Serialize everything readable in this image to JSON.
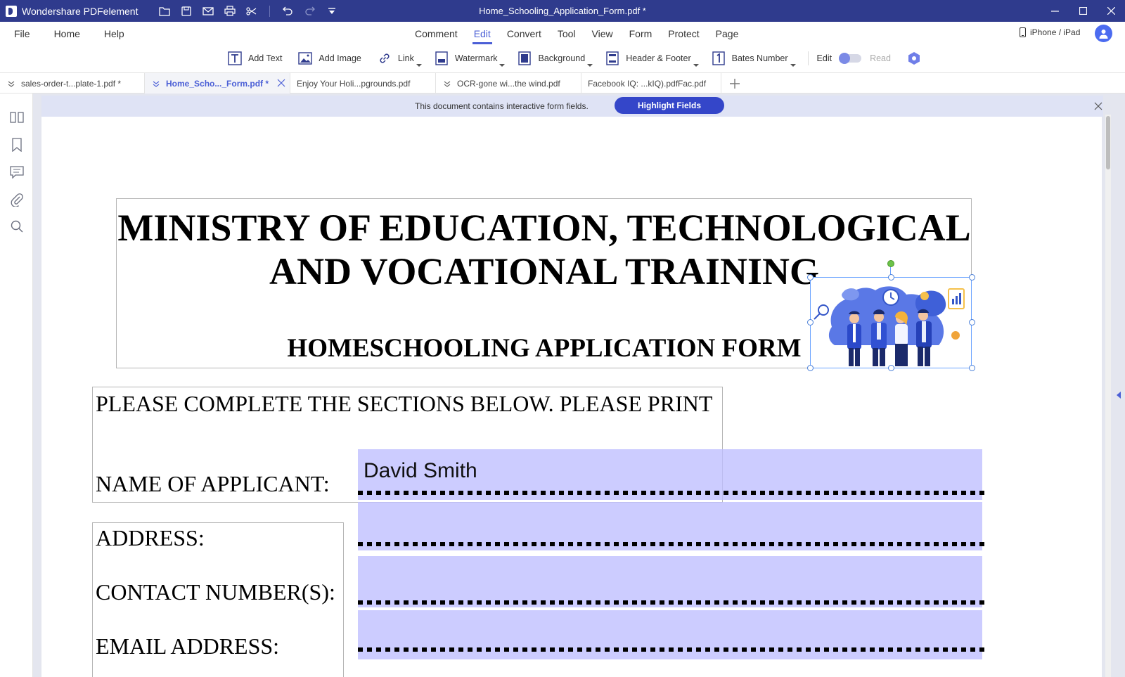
{
  "app": {
    "name": "Wondershare PDFelement",
    "window_title": "Home_Schooling_Application_Form.pdf *"
  },
  "menu": {
    "left": [
      "File",
      "Home",
      "Help"
    ],
    "center": [
      "Comment",
      "Edit",
      "Convert",
      "Tool",
      "View",
      "Form",
      "Protect",
      "Page"
    ],
    "active": "Edit",
    "device_label": "iPhone / iPad"
  },
  "toolbar": {
    "add_text": "Add Text",
    "add_image": "Add Image",
    "link": "Link",
    "watermark": "Watermark",
    "background": "Background",
    "header_footer": "Header & Footer",
    "bates_number": "Bates Number",
    "mode_edit": "Edit",
    "mode_read": "Read"
  },
  "tabs": [
    {
      "label": "sales-order-t...plate-1.pdf *",
      "active": false
    },
    {
      "label": "Home_Scho..._Form.pdf *",
      "active": true
    },
    {
      "label": "Enjoy Your Holi...pgrounds.pdf",
      "active": false
    },
    {
      "label": "OCR-gone  wi...the wind.pdf",
      "active": false
    },
    {
      "label": "Facebook  IQ:   ...kIQ).pdfFac.pdf",
      "active": false
    }
  ],
  "notice": {
    "message": "This document contains interactive form fields.",
    "button": "Highlight Fields"
  },
  "document": {
    "title_line1": "MINISTRY OF EDUCATION, TECHNOLOGICAL",
    "title_line2": "AND VOCATIONAL TRAINING",
    "form_title": "HOMESCHOOLING APPLICATION FORM",
    "instructions": "PLEASE COMPLETE THE SECTIONS BELOW.  PLEASE PRINT",
    "labels": {
      "name": "NAME OF APPLICANT:",
      "address": "ADDRESS:",
      "contact": "CONTACT NUMBER(S):",
      "email": "EMAIL ADDRESS:"
    },
    "fields": {
      "name": "David Smith",
      "address": "",
      "contact": "",
      "email": ""
    }
  },
  "colors": {
    "titlebar": "#2f3b8d",
    "accent": "#4b5fd6",
    "field_highlight": "#bebeff"
  }
}
